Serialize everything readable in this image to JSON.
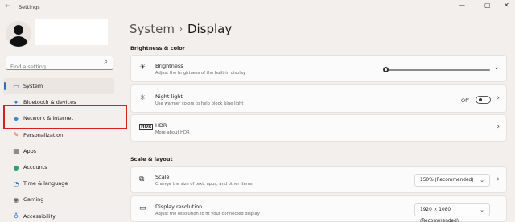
{
  "window": {
    "title": "Settings",
    "back_icon": "←",
    "minimize": "—",
    "maximize": "▢",
    "close": "✕"
  },
  "search": {
    "placeholder": "Find a setting",
    "icon": "⌕"
  },
  "sidebar": {
    "items": [
      {
        "label": "System",
        "icon": "▭",
        "color": "#3a6fb0"
      },
      {
        "label": "Bluetooth & devices",
        "icon": "✦",
        "color": "#2f7fd6"
      },
      {
        "label": "Network & internet",
        "icon": "◆",
        "color": "#2f8fd8"
      },
      {
        "label": "Personalization",
        "icon": "✎",
        "color": "#c9683a"
      },
      {
        "label": "Apps",
        "icon": "▦",
        "color": "#666666"
      },
      {
        "label": "Accounts",
        "icon": "●",
        "color": "#2fa07a"
      },
      {
        "label": "Time & language",
        "icon": "◔",
        "color": "#2f7fd6"
      },
      {
        "label": "Gaming",
        "icon": "◉",
        "color": "#666666"
      },
      {
        "label": "Accessibility",
        "icon": "♁",
        "color": "#2f7fd6"
      }
    ]
  },
  "header": {
    "crumb_parent": "System",
    "crumb_sep": "›",
    "crumb_current": "Display"
  },
  "sections": {
    "brightness_color": "Brightness & color",
    "scale_layout": "Scale & layout"
  },
  "cards": {
    "brightness": {
      "icon": "☀",
      "title": "Brightness",
      "sub": "Adjust the brightness of the built-in display",
      "chevron": "⌄",
      "level": 0
    },
    "night_light": {
      "icon": "☼",
      "title": "Night light",
      "sub": "Use warmer colors to help block blue light",
      "state": "Off",
      "chevron": "›"
    },
    "hdr": {
      "icon": "HDR",
      "title": "HDR",
      "sub": "More about HDR",
      "chevron": "›"
    },
    "scale": {
      "icon": "⧉",
      "title": "Scale",
      "sub": "Change the size of text, apps, and other items",
      "value": "150% (Recommended)",
      "chevron": "›"
    },
    "resolution": {
      "icon": "▭",
      "title": "Display resolution",
      "sub": "Adjust the resolution to fit your connected display",
      "value": "1920 × 1080 (Recommended)"
    }
  },
  "dropdown_chevron": "⌄"
}
